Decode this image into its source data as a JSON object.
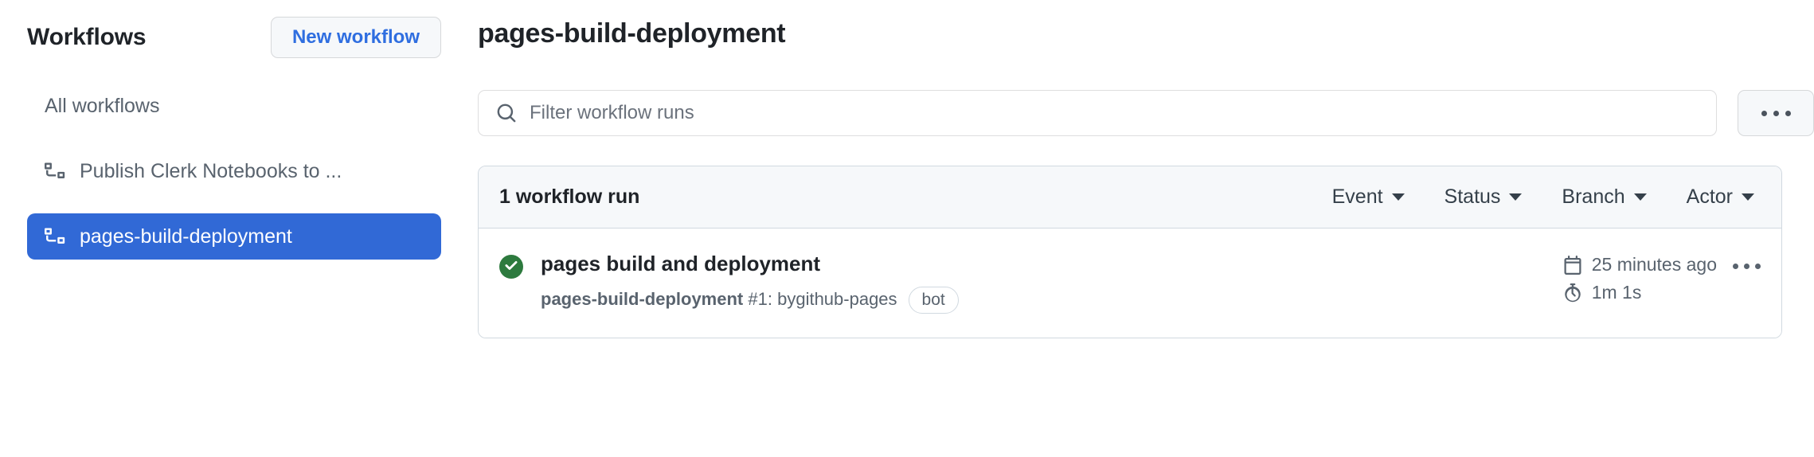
{
  "sidebar": {
    "title": "Workflows",
    "new_workflow_label": "New workflow",
    "items": [
      {
        "label": "All workflows",
        "icon": "",
        "selected": false
      },
      {
        "label": "Publish Clerk Notebooks to ...",
        "icon": "workflow-icon",
        "selected": false
      },
      {
        "label": "pages-build-deployment",
        "icon": "workflow-icon",
        "selected": true
      }
    ]
  },
  "main": {
    "page_title": "pages-build-deployment",
    "search": {
      "placeholder": "Filter workflow runs",
      "value": "",
      "icon": "search-icon"
    },
    "overflow_button": {
      "icon": "kebab-horizontal-icon",
      "label": "..."
    },
    "runs_card": {
      "count_label": "1 workflow run",
      "filters": [
        {
          "label": "Event",
          "icon": "chevron-down-icon"
        },
        {
          "label": "Status",
          "icon": "chevron-down-icon"
        },
        {
          "label": "Branch",
          "icon": "chevron-down-icon"
        },
        {
          "label": "Actor",
          "icon": "chevron-down-icon"
        }
      ],
      "runs": [
        {
          "status": "success",
          "status_icon": "check-circle-fill-icon",
          "status_color": "#2d7a3e",
          "title": "pages build and deployment",
          "workflow_name": "pages-build-deployment",
          "run_number": "#1",
          "by_text": ": by ",
          "actor": "github-pages",
          "badge": "bot",
          "time_icon": "calendar-icon",
          "time_ago": "25 minutes ago",
          "duration_icon": "stopwatch-icon",
          "duration": "1m 1s",
          "row_menu_icon": "kebab-horizontal-icon"
        }
      ]
    }
  },
  "colors": {
    "accent_blue": "#3169d6",
    "link_blue": "#2f6ee0",
    "success_green": "#2d7a3e",
    "border": "#d1d9e0",
    "header_bg": "#f6f8fa",
    "muted_text": "#59636e"
  }
}
